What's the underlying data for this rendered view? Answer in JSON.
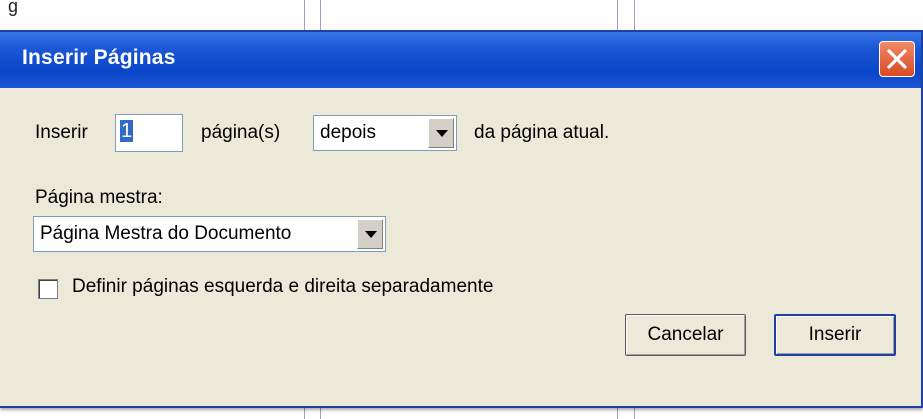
{
  "background": {
    "partial_text": "g"
  },
  "dialog": {
    "title": "Inserir Páginas",
    "close_icon": "close-icon",
    "insert_label": "Inserir",
    "page_count": "1",
    "pages_unit_label": "página(s)",
    "position_select": {
      "value": "depois"
    },
    "relative_label": "da página atual.",
    "master_label": "Página mestra:",
    "master_select": {
      "value": "Página Mestra do Documento"
    },
    "separate_checkbox": {
      "label": "Definir páginas esquerda e direita separadamente",
      "checked": false
    },
    "buttons": {
      "cancel": "Cancelar",
      "insert": "Inserir"
    }
  },
  "colors": {
    "titlebar": "#0a46c8",
    "body": "#ece9d8",
    "close": "#d84a22"
  }
}
